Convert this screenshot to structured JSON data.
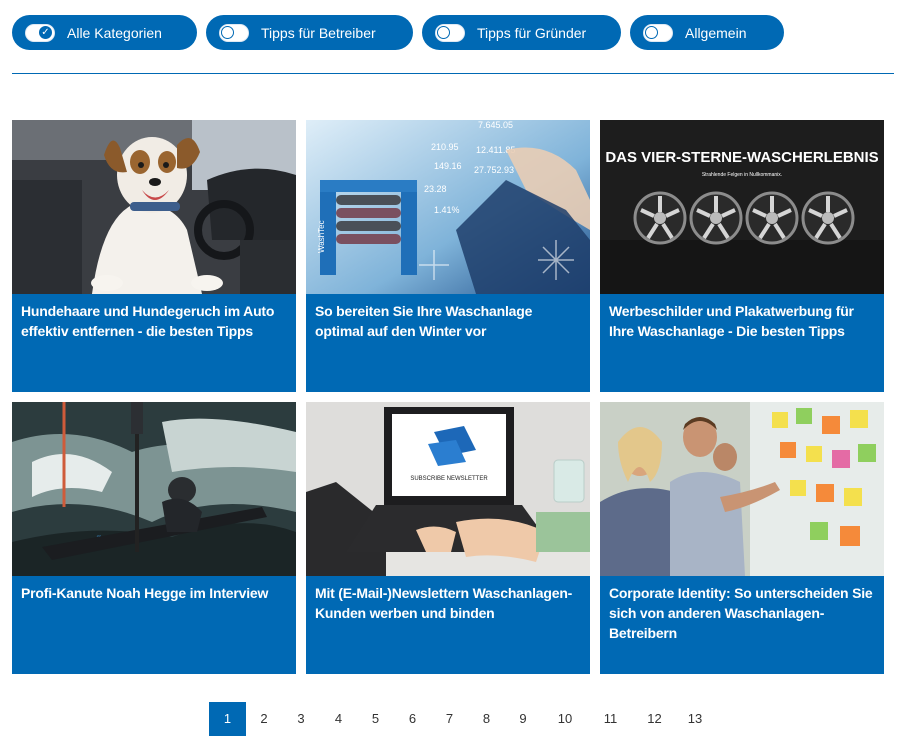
{
  "filters": [
    {
      "label": "Alle Kategorien",
      "active": true
    },
    {
      "label": "Tipps für Betreiber",
      "active": false
    },
    {
      "label": "Tipps für Gründer",
      "active": false
    },
    {
      "label": "Allgemein",
      "active": false
    }
  ],
  "cards": [
    {
      "title": "Hundehaare und Hundegeruch im Auto effektiv entfernen - die besten Tipps",
      "image": "dog-in-car"
    },
    {
      "title": "So bereiten Sie Ihre Waschanlage optimal auf den Winter vor",
      "image": "car-wash-winter",
      "image_text": [
        "7.645.05",
        "210.95",
        "12.411.85",
        "149.16",
        "27.752.93",
        "23.28",
        "1.41%",
        "WashTec"
      ]
    },
    {
      "title": "Werbeschilder und Plakatwerbung für Ihre Waschanlage - Die besten Tipps",
      "image": "wheel-rims-ad",
      "image_text": [
        "DAS VIER-STERNE-WASCHERLEBNIS",
        "Strahlende Felgen in Nullkommanix."
      ]
    },
    {
      "title": "Profi-Kanute Noah Hegge im Interview",
      "image": "kayak-whitewater"
    },
    {
      "title": "Mit (E-Mail-)Newslettern Waschanlagen-Kunden werben und binden",
      "image": "laptop-newsletter",
      "image_text": [
        "SUBSCRIBE NEWSLETTER"
      ]
    },
    {
      "title": "Corporate Identity: So unterscheiden Sie sich von anderen Waschanlagen-Betreibern",
      "image": "team-sticky-notes"
    }
  ],
  "pagination": {
    "current": "1",
    "pages": [
      "1",
      "2",
      "3",
      "4",
      "5",
      "6",
      "7",
      "8",
      "9",
      "10",
      "11",
      "12",
      "13"
    ]
  },
  "colors": {
    "brand": "#0069b4",
    "text": "#333333"
  }
}
